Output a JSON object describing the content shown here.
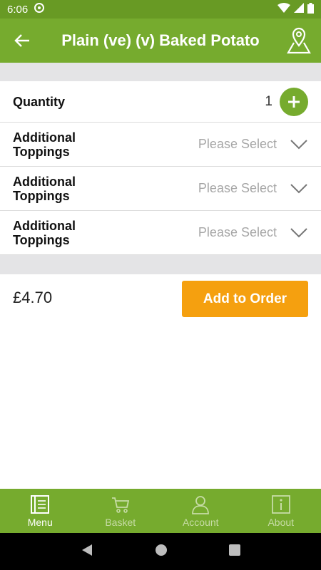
{
  "status_bar": {
    "time": "6:06"
  },
  "app_bar": {
    "title": "Plain (ve) (v) Baked Potato"
  },
  "quantity": {
    "label": "Quantity",
    "value": "1"
  },
  "options": [
    {
      "label_line1": "Additional",
      "label_line2": "Toppings",
      "placeholder": "Please Select"
    },
    {
      "label_line1": "Additional",
      "label_line2": "Toppings",
      "placeholder": "Please Select"
    },
    {
      "label_line1": "Additional",
      "label_line2": "Toppings",
      "placeholder": "Please Select"
    }
  ],
  "order": {
    "price": "£4.70",
    "add_label": "Add to Order"
  },
  "tabs": [
    {
      "label": "Menu",
      "icon": "menu-book-icon",
      "active": true
    },
    {
      "label": "Basket",
      "icon": "cart-icon",
      "active": false
    },
    {
      "label": "Account",
      "icon": "person-icon",
      "active": false
    },
    {
      "label": "About",
      "icon": "info-icon",
      "active": false
    }
  ],
  "colors": {
    "brand_green": "#76ab2e",
    "status_green": "#689a24",
    "accent_orange": "#f5a00f"
  }
}
